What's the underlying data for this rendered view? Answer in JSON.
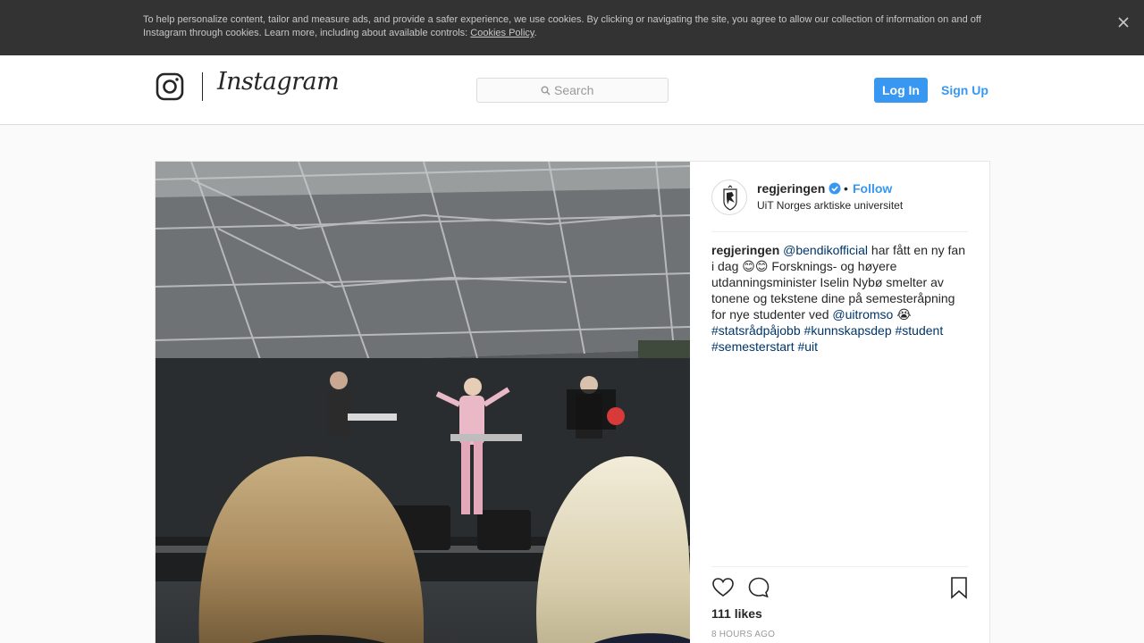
{
  "cookie_banner": {
    "text": "To help personalize content, tailor and measure ads, and provide a safer experience, we use cookies. By clicking or navigating the site, you agree to allow our collection of information on and off Instagram through cookies. Learn more, including about available controls: ",
    "link_label": "Cookies Policy",
    "trailing": ".",
    "close_icon": "close-icon"
  },
  "header": {
    "logo_text": "Instagram",
    "logo_icon": "camera-glyph-icon",
    "search_placeholder": "Search",
    "login_label": "Log In",
    "signup_label": "Sign Up"
  },
  "post": {
    "username": "regjeringen",
    "verified": true,
    "separator": "•",
    "follow_label": "Follow",
    "location": "UiT Norges arktiske universitet",
    "caption": {
      "user": "regjeringen",
      "mention1": "@bendikofficial",
      "text1": " har fått en ny fan i dag 😊😊 Forsknings- og høyere utdanningsminister Iselin Nybø smelter av tonene og tekstene dine på semesteråpning for nye studenter ved ",
      "mention2": "@uitromso",
      "text2": " 😭 ",
      "hashtags": [
        "#statsrådpåjobb",
        "#kunnskapsdep",
        "#student",
        "#semesterstart",
        "#uit"
      ]
    },
    "likes": "111 likes",
    "time_ago": "8 hours ago",
    "icons": [
      "heart-icon",
      "comment-icon",
      "bookmark-icon"
    ]
  },
  "colors": {
    "accent": "#3897f0",
    "banner_bg": "#333333",
    "hashtag": "#003569"
  }
}
